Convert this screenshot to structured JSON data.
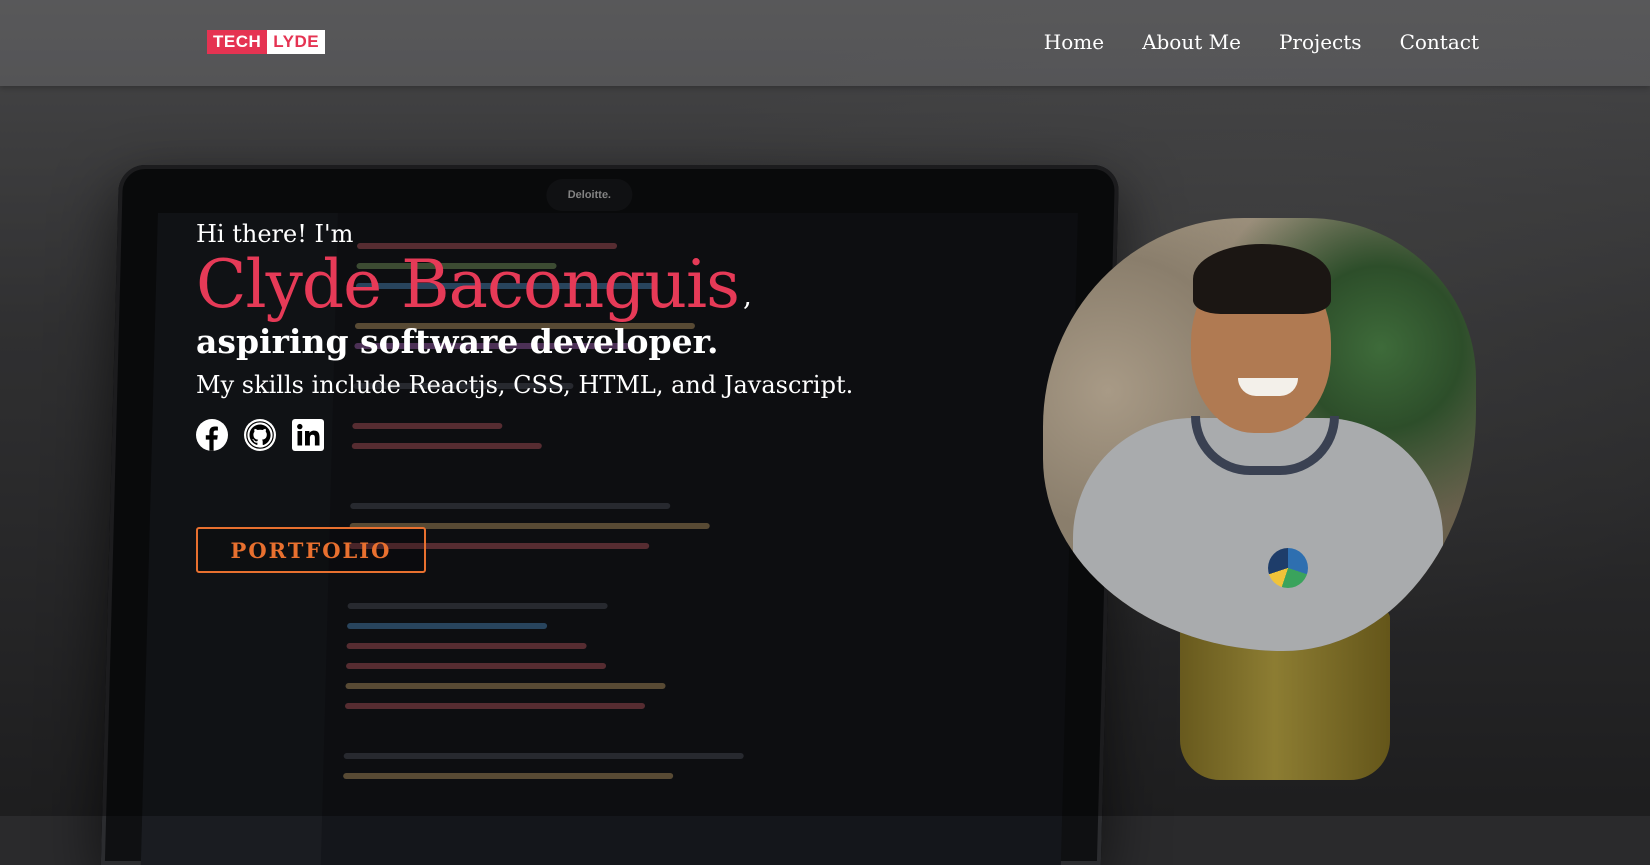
{
  "brand": {
    "part1": "TECH",
    "part2": "LYDE"
  },
  "nav": [
    {
      "label": "Home"
    },
    {
      "label": "About Me"
    },
    {
      "label": "Projects"
    },
    {
      "label": "Contact"
    }
  ],
  "hero": {
    "greeting": "Hi there! I'm",
    "name": "Clyde Baconguis",
    "comma": ",",
    "role": "aspiring software developer.",
    "skills": "My skills include Reactjs, CSS, HTML, and Javascript.",
    "portfolio_label": "PORTFOLIO"
  },
  "socials": [
    {
      "icon": "facebook-icon"
    },
    {
      "icon": "github-icon"
    },
    {
      "icon": "linkedin-icon"
    }
  ],
  "background": {
    "laptop_badge": "Deloitte."
  },
  "colors": {
    "accent_pink": "#e63a57",
    "accent_orange": "#e8702f",
    "text": "#ffffff"
  }
}
